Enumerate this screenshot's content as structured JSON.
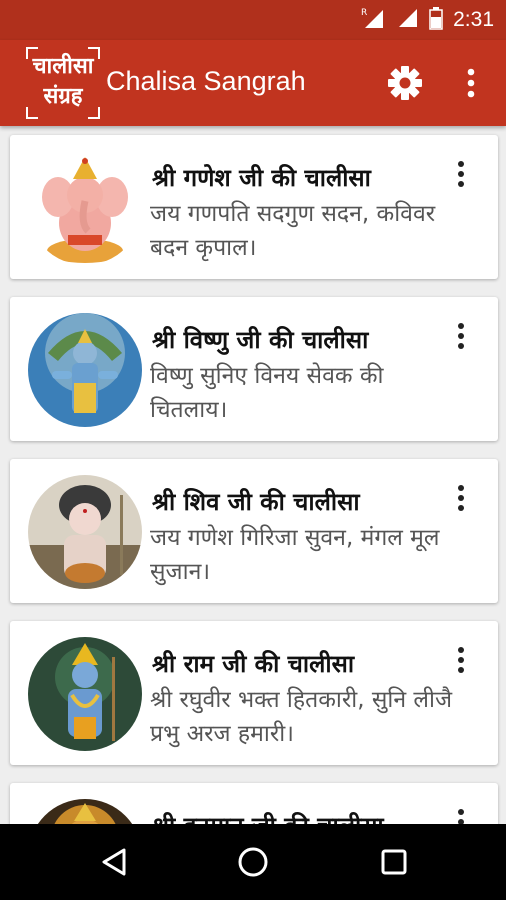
{
  "status_bar": {
    "time": "2:31",
    "icons": [
      "roaming-signal-icon",
      "signal-icon",
      "battery-icon"
    ]
  },
  "app_bar": {
    "logo_line1": "चालीसा",
    "logo_line2": "संग्रह",
    "title": "Chalisa Sangrah",
    "icons": [
      "settings-icon",
      "overflow-menu-icon"
    ]
  },
  "chalisas": [
    {
      "title": "श्री गणेश जी की चालीसा",
      "text": "जय गणपति सदगुण सदन, कविवर बदन कृपाल।",
      "image": "ganesh-image"
    },
    {
      "title": "श्री विष्णु जी की चालीसा",
      "text": "विष्णु सुनिए विनय सेवक की चितलाय।",
      "image": "vishnu-image"
    },
    {
      "title": "श्री शिव जी की चालीसा",
      "text": "जय गणेश गिरिजा सुवन, मंगल मूल सुजान।",
      "image": "shiva-image"
    },
    {
      "title": "श्री राम जी की चालीसा",
      "text": "श्री रघुवीर भक्त हितकारी, सुनि लीजै प्रभु अरज हमारी।",
      "image": "ram-image"
    },
    {
      "title": "श्री हनुमान जी की चालीसा",
      "text": "",
      "image": "hanuman-image"
    }
  ],
  "nav_bar": {
    "icons": [
      "back-icon",
      "home-icon",
      "recents-icon"
    ]
  },
  "colors": {
    "status_bar": "#b0301c",
    "app_bar": "#c1341f",
    "background": "#eeeeee"
  }
}
